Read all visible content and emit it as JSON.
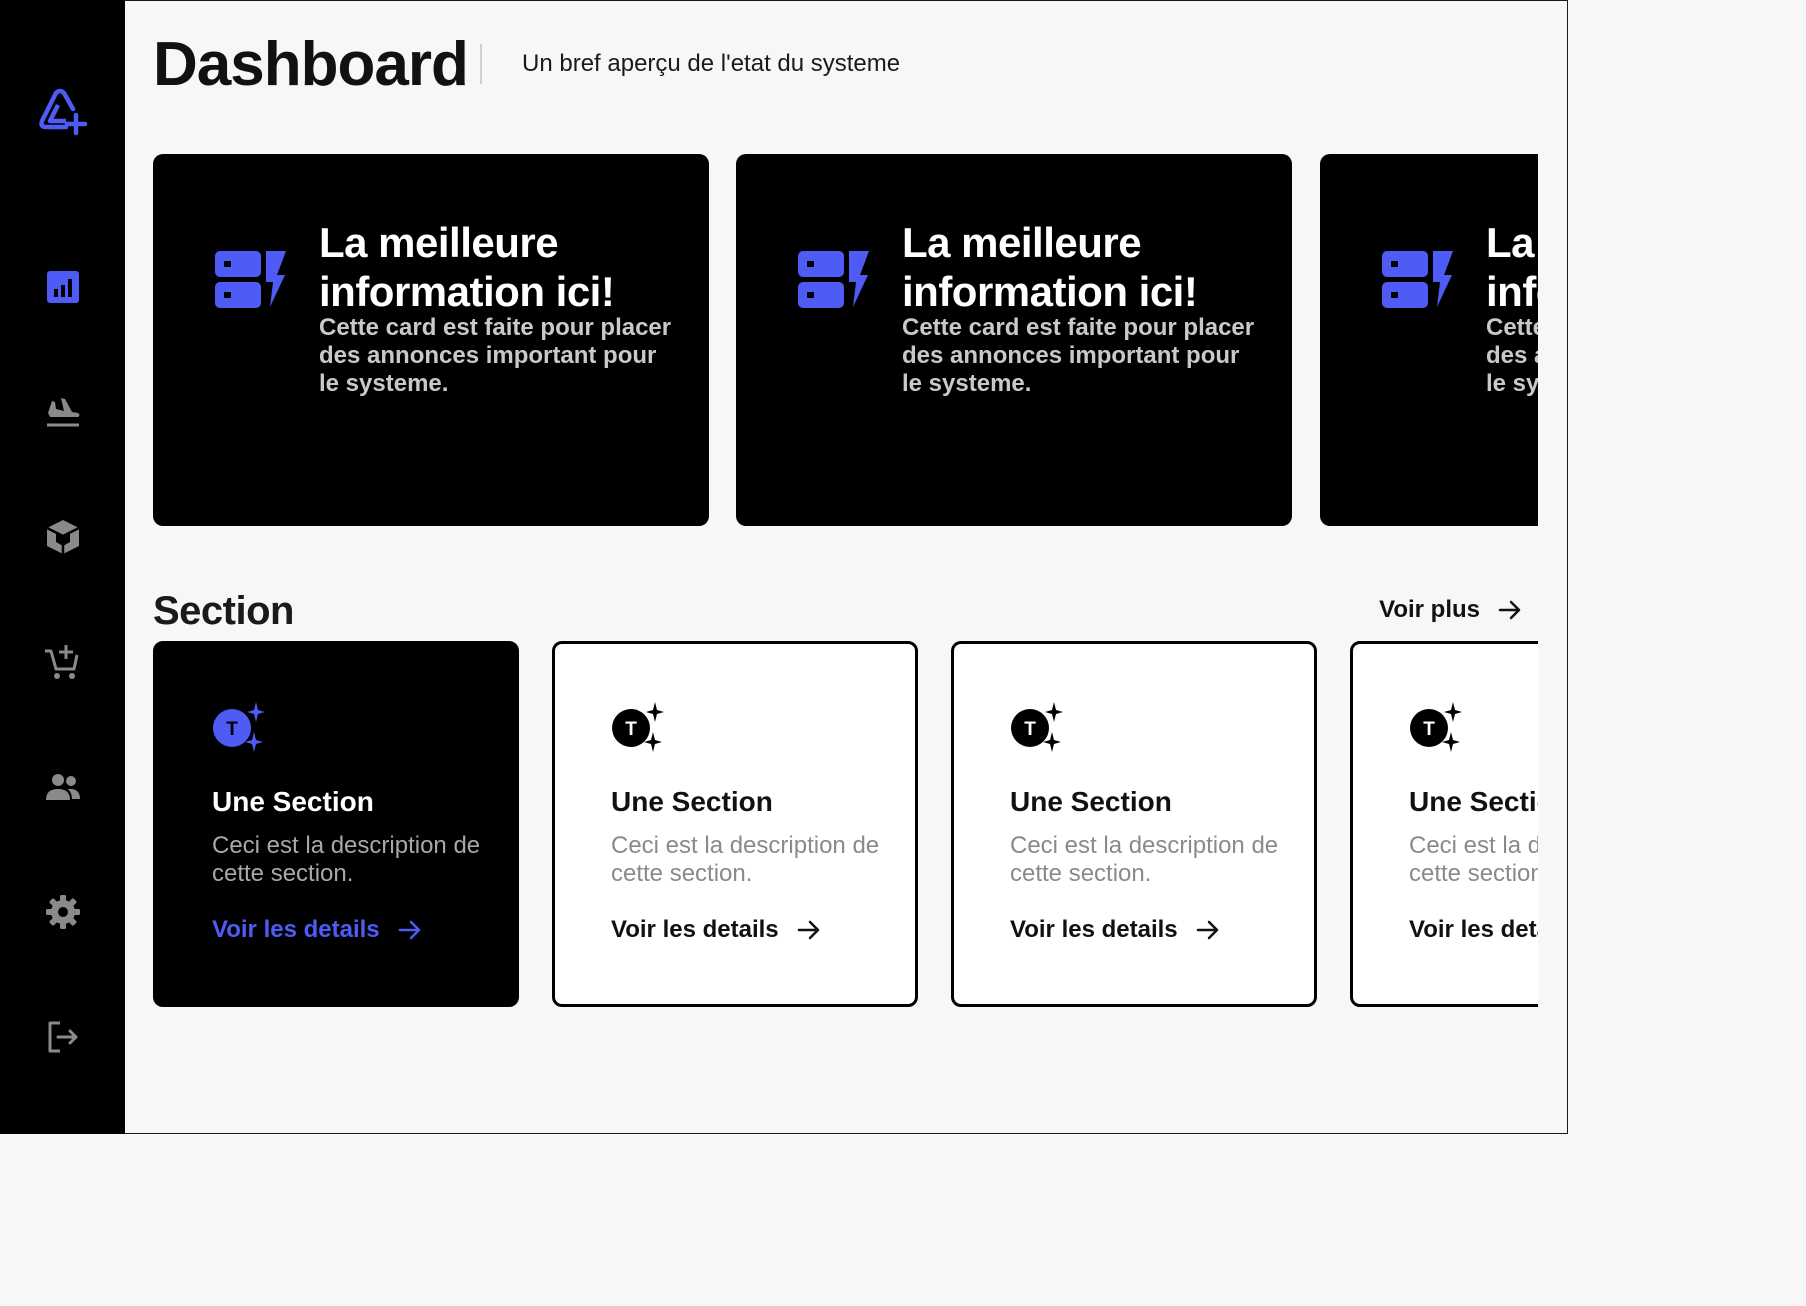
{
  "colors": {
    "accent": "#4f5bf5",
    "sidebar_bg": "#000000",
    "page_bg": "#f7f7f7",
    "icon_muted": "#8a8a8a"
  },
  "sidebar": {
    "logo_icon": "logo-icon",
    "items": [
      {
        "icon": "chart-icon",
        "active": true
      },
      {
        "icon": "plane-icon",
        "active": false
      },
      {
        "icon": "box-icon",
        "active": false
      },
      {
        "icon": "cart-add-icon",
        "active": false
      },
      {
        "icon": "users-icon",
        "active": false
      },
      {
        "icon": "gear-icon",
        "active": false
      },
      {
        "icon": "logout-icon",
        "active": false
      }
    ]
  },
  "header": {
    "title": "Dashboard",
    "subtitle": "Un bref aperçu de l'etat du systeme"
  },
  "info_cards": [
    {
      "icon": "server-bolt-icon",
      "title": "La meilleure information ici!",
      "description": "Cette card est faite pour placer des annonces important pour le systeme."
    },
    {
      "icon": "server-bolt-icon",
      "title": "La meilleure information ici!",
      "description": "Cette card est faite pour placer des annonces important pour le systeme."
    },
    {
      "icon": "server-bolt-icon",
      "title": "La meilleure information ici!",
      "description": "Cette card est faite pour placer des annonces important pour le systeme."
    }
  ],
  "section": {
    "title": "Section",
    "see_more": "Voir plus",
    "cards": [
      {
        "icon": "sparkle-t-icon",
        "title": "Une Section",
        "description": "Ceci est la description de cette section.",
        "link": "Voir les details",
        "style": "dark"
      },
      {
        "icon": "sparkle-t-icon",
        "title": "Une Section",
        "description": "Ceci est la description de cette section.",
        "link": "Voir les details",
        "style": "light"
      },
      {
        "icon": "sparkle-t-icon",
        "title": "Une Section",
        "description": "Ceci est la description de cette section.",
        "link": "Voir les details",
        "style": "light"
      },
      {
        "icon": "sparkle-t-icon",
        "title": "Une Section",
        "description": "Ceci est la description de cette section.",
        "link": "Voir les details",
        "style": "light"
      }
    ]
  }
}
